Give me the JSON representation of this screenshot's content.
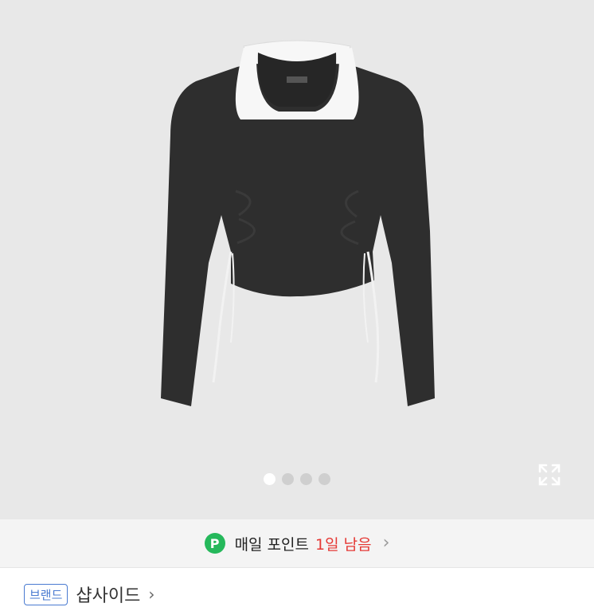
{
  "carousel": {
    "slide_count": 4,
    "active_index": 0
  },
  "points": {
    "badge": "P",
    "label": "매일 포인트",
    "remaining": "1일 남음",
    "chevron": "›"
  },
  "brand": {
    "tag": "브랜드",
    "name": "샵사이드",
    "chevron": "›"
  },
  "icons": {
    "expand": "expand-icon"
  },
  "colors": {
    "garment_black": "#2e2e2e",
    "tank_white": "#f7f7f7",
    "points_green": "#25b85b",
    "remaining_red": "#e53935"
  }
}
